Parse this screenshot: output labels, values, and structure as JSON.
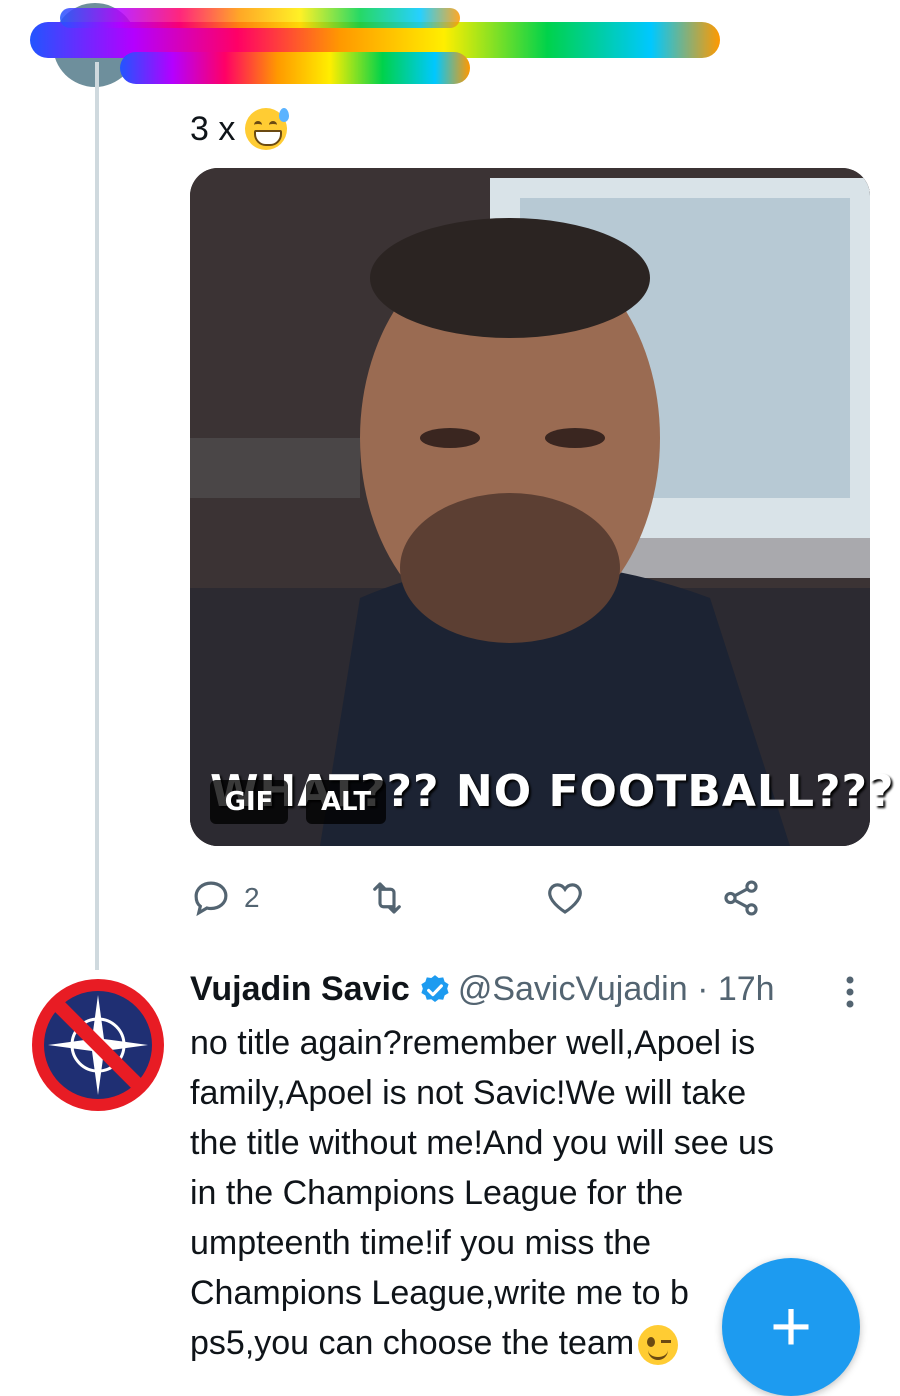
{
  "previous_tweet": {
    "text": "3 x",
    "emoji": "sweat-smile-emoji",
    "media": {
      "caption": "WHAT??? NO FOOTBALL???",
      "gif_badge": "GIF",
      "alt_badge": "ALT"
    },
    "actions": {
      "reply_count": "2"
    }
  },
  "reply_tweet": {
    "author_name": "Vujadin Savic",
    "handle_time": "@SavicVujadin · 17h",
    "lines": [
      "no title again?remember well,Apoel is",
      "family,Apoel is not Savic!We will take",
      "the title without me!And you will see us",
      "in the Champions League for the",
      "umpteenth time!if you miss the",
      "Champions League,write me to b",
      "ps5,you can choose the team"
    ]
  },
  "fab": {
    "label": "+"
  },
  "colors": {
    "accent": "#1d9bf0",
    "muted": "#536471",
    "thread_line": "#cfd9de"
  }
}
